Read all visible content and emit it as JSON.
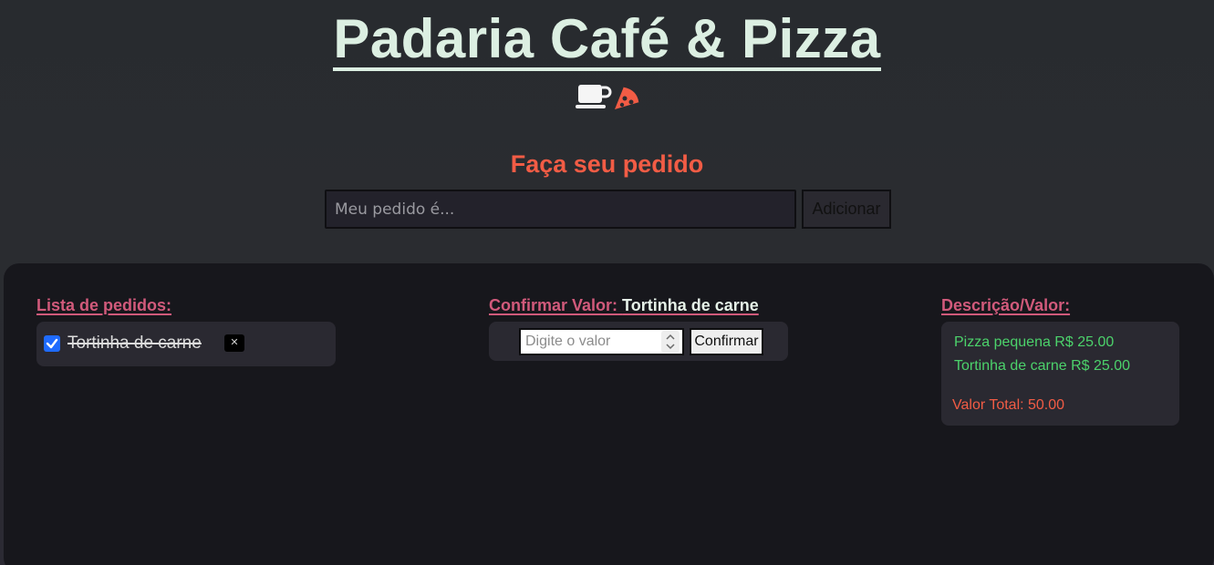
{
  "header": {
    "title": "Padaria Café & Pizza",
    "icons": [
      "coffee-cup-icon",
      "pizza-slice-icon"
    ]
  },
  "order_form": {
    "title": "Faça seu pedido",
    "input_placeholder": "Meu pedido é...",
    "input_value": "",
    "add_label": "Adicionar"
  },
  "orders_list": {
    "heading": "Lista de pedidos:",
    "items": [
      {
        "label": "Tortinha de carne",
        "checked": true,
        "delete_label": "✕"
      }
    ]
  },
  "confirm_value": {
    "heading": "Confirmar Valor:",
    "item_name": "Tortinha de carne",
    "input_placeholder": "Digite o valor",
    "confirm_label": "Confirmar"
  },
  "description": {
    "heading": "Descrição/Valor:",
    "lines": [
      "Pizza pequena R$ 25.00",
      "Tortinha de carne R$ 25.00"
    ],
    "total": "Valor Total: 50.00"
  },
  "colors": {
    "title": "#dcefe2",
    "accent_orange": "#f25c45",
    "heading_pink": "#d15a7b",
    "price_green": "#4cd26b",
    "checkbox_blue": "#1f6bff"
  }
}
